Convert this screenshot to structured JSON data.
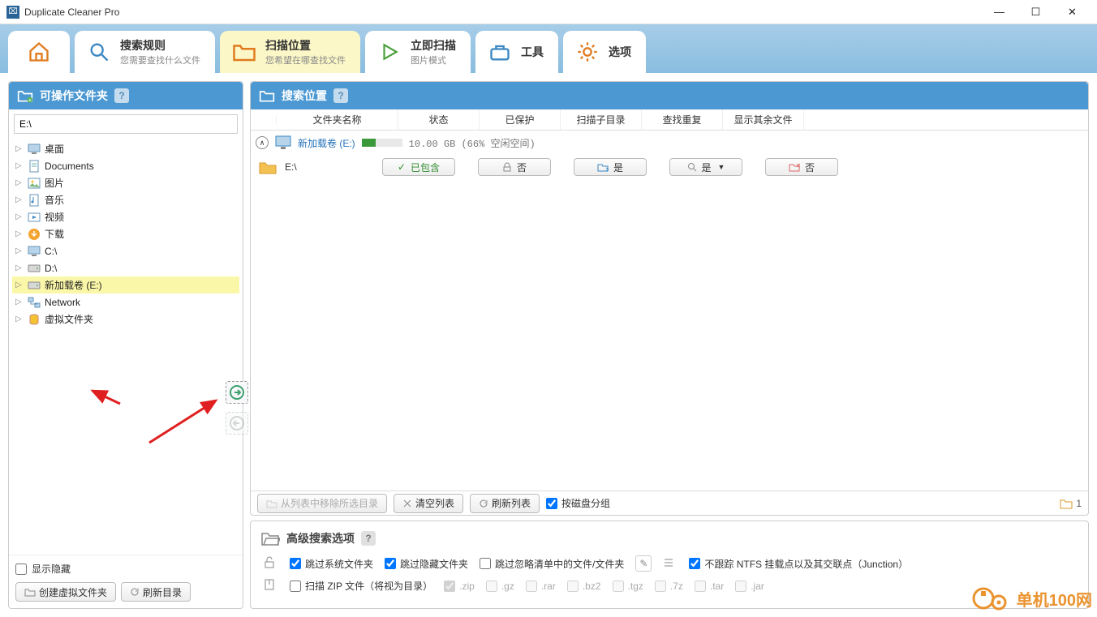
{
  "app": {
    "title": "Duplicate Cleaner Pro"
  },
  "nav": {
    "search_rules": {
      "title": "搜索规则",
      "sub": "您需要查找什么文件"
    },
    "scan_location": {
      "title": "扫描位置",
      "sub": "您希望在哪查找文件"
    },
    "scan_now": {
      "title": "立即扫描",
      "sub": "图片模式"
    },
    "tools": "工具",
    "options": "选项"
  },
  "left": {
    "header": "可操作文件夹",
    "path": "E:\\",
    "tree": {
      "desktop": "桌面",
      "documents": "Documents",
      "pictures": "图片",
      "music": "音乐",
      "videos": "视频",
      "downloads": "下载",
      "c": "C:\\",
      "d": "D:\\",
      "e": "新加载卷 (E:)",
      "network": "Network",
      "virtual": "虚拟文件夹"
    },
    "show_hidden": "显示隐藏",
    "create_virtual": "创建虚拟文件夹",
    "refresh_dir": "刷新目录"
  },
  "right": {
    "header": "搜索位置",
    "cols": {
      "name": "文件夹名称",
      "status": "状态",
      "protected": "已保护",
      "scan_sub": "扫描子目录",
      "find_dup": "查找重复",
      "show_rest": "显示其余文件"
    },
    "drive": {
      "name": "新加载卷 (E:)",
      "free": "10.00 GB (66% 空闲空间)"
    },
    "row": {
      "name": "E:\\",
      "included": "已包含",
      "protected_no": "否",
      "scan_sub_yes": "是",
      "find_dup_yes": "是",
      "show_rest_no": "否"
    },
    "toolbar": {
      "remove_sel": "从列表中移除所选目录",
      "clear_list": "清空列表",
      "refresh_list": "刷新列表",
      "group_by_disk": "按磁盘分组",
      "count": "1"
    }
  },
  "adv": {
    "title": "高级搜索选项",
    "skip_system": "跳过系统文件夹",
    "skip_hidden": "跳过隐藏文件夹",
    "skip_ignore_list": "跳过忽略清单中的文件/文件夹",
    "no_follow_junction": "不跟踪 NTFS 挂载点以及其交联点（Junction）",
    "scan_zip": "扫描 ZIP 文件（将视为目录）",
    "ext": {
      "zip": ".zip",
      "gz": ".gz",
      "rar": ".rar",
      "bz2": ".bz2",
      "tgz": ".tgz",
      "7z": ".7z",
      "tar": ".tar",
      "jar": ".jar"
    }
  },
  "watermark": {
    "text": "单机100网"
  }
}
